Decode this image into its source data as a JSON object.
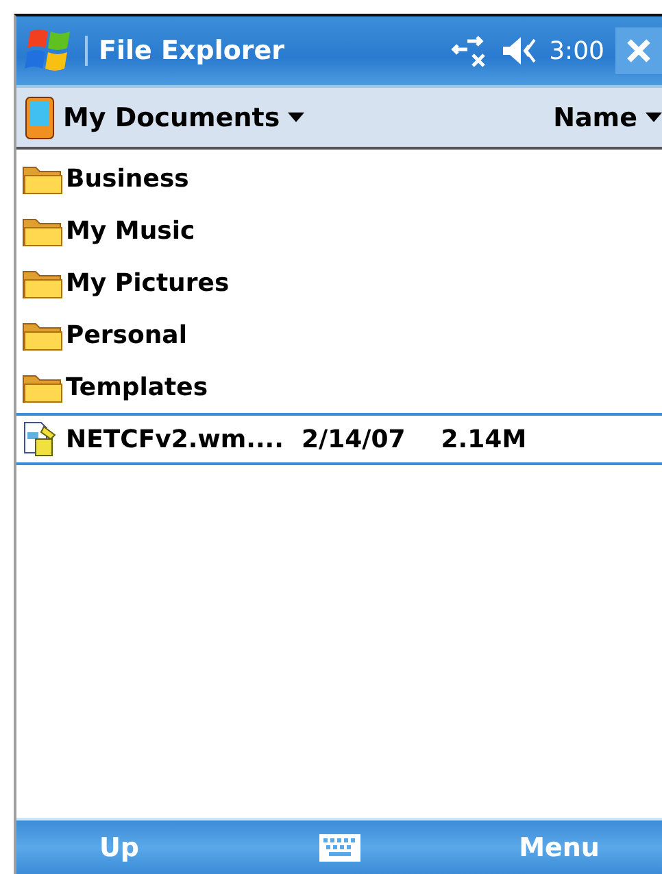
{
  "window": {
    "title": "File Explorer",
    "time": "3:00"
  },
  "location": {
    "folder": "My Documents",
    "sort": "Name"
  },
  "items": [
    {
      "kind": "folder",
      "name": "Business",
      "selected": false
    },
    {
      "kind": "folder",
      "name": "My Music",
      "selected": false
    },
    {
      "kind": "folder",
      "name": "My Pictures",
      "selected": false
    },
    {
      "kind": "folder",
      "name": "Personal",
      "selected": false
    },
    {
      "kind": "folder",
      "name": "Templates",
      "selected": false
    },
    {
      "kind": "file",
      "name": "NETCFv2.wm....",
      "date": "2/14/07",
      "size": "2.14M",
      "selected": true
    }
  ],
  "softkeys": {
    "left": "Up",
    "right": "Menu"
  }
}
